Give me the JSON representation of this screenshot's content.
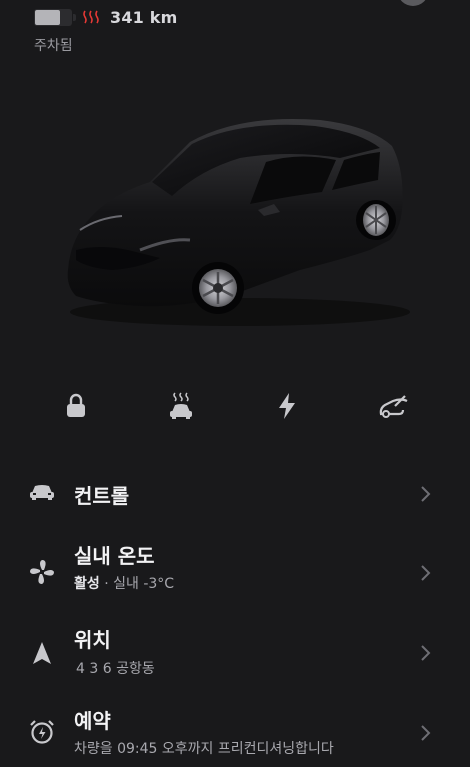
{
  "status": {
    "battery_level": 0.7,
    "range": "341 km",
    "state": "주차됨"
  },
  "quick_actions": [
    {
      "name": "lock-icon"
    },
    {
      "name": "seat-heat-icon"
    },
    {
      "name": "charge-icon"
    },
    {
      "name": "trunk-icon"
    }
  ],
  "menu": {
    "controls": {
      "title": "컨트롤"
    },
    "climate": {
      "title": "실내 온도",
      "sub_status": "활성",
      "sub_detail": " · 실내 -3°C"
    },
    "location": {
      "title": "위치",
      "sub": "4 3 6 공항동"
    },
    "schedule": {
      "title": "예약",
      "sub": "차량을 09:45 오후까지 프리컨디셔닝합니다"
    }
  },
  "colors": {
    "background": "#19191b",
    "heat_accent": "#e53935",
    "icon": "#c8c8cc"
  }
}
